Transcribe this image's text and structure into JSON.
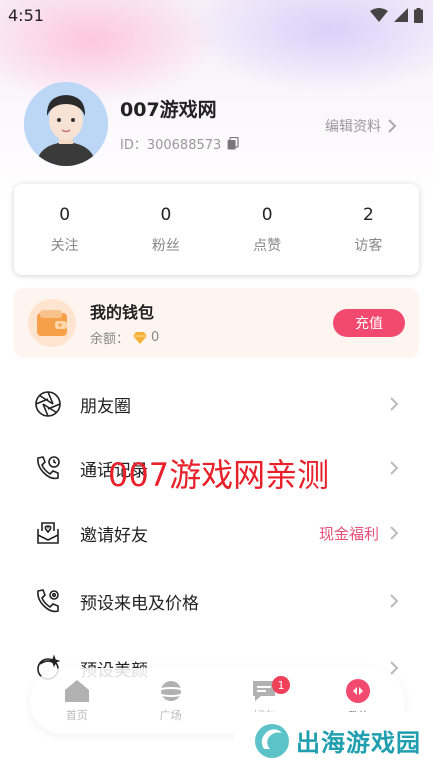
{
  "status_bar": {
    "time": "4:51"
  },
  "profile": {
    "username": "007游戏网",
    "user_id": "ID：300688573",
    "edit_label": "编辑资料"
  },
  "stats": [
    {
      "value": "0",
      "label": "关注"
    },
    {
      "value": "0",
      "label": "粉丝"
    },
    {
      "value": "0",
      "label": "点赞"
    },
    {
      "value": "2",
      "label": "访客"
    }
  ],
  "wallet": {
    "title": "我的钱包",
    "balance_label": "余额：",
    "balance_value": "0",
    "recharge_label": "充值"
  },
  "menu": [
    {
      "label": "朋友圈",
      "extra": "",
      "icon": "aperture-icon"
    },
    {
      "label": "通话记录",
      "extra": "",
      "icon": "phone-history-icon"
    },
    {
      "label": "邀请好友",
      "extra": "现金福利",
      "icon": "envelope-heart-icon"
    },
    {
      "label": "预设来电及价格",
      "extra": "",
      "icon": "phone-settings-icon"
    },
    {
      "label": "预设美颜",
      "extra": "",
      "icon": "beauty-icon"
    }
  ],
  "watermark": "007游戏网亲测",
  "bottom_nav": [
    {
      "label": "首页",
      "icon": "home-icon"
    },
    {
      "label": "广场",
      "icon": "planet-icon"
    },
    {
      "label": "好友",
      "icon": "chat-icon",
      "badge": "1"
    },
    {
      "label": "我的",
      "icon": "profile-icon"
    }
  ],
  "corner_logo": "出海游戏园",
  "colors": {
    "accent": "#f24a6f",
    "invite_extra": "#e8517a",
    "watermark": "#e8202a",
    "logo": "#1f9fb0"
  }
}
